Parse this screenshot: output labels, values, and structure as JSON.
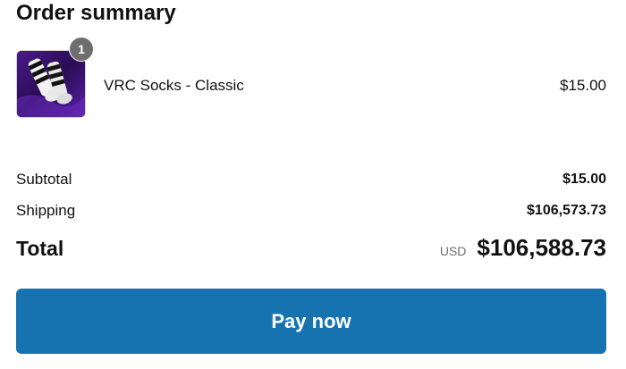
{
  "summary": {
    "title": "Order summary"
  },
  "line_item": {
    "quantity": "1",
    "name": "VRC Socks - Classic",
    "price": "$15.00",
    "thumbnail_icon": "socks-product-image"
  },
  "costs": {
    "subtotal_label": "Subtotal",
    "subtotal_value": "$15.00",
    "shipping_label": "Shipping",
    "shipping_value": "$106,573.73"
  },
  "total": {
    "label": "Total",
    "currency": "USD",
    "value": "$106,588.73"
  },
  "actions": {
    "pay_label": "Pay now"
  },
  "colors": {
    "button": "#1773b0",
    "badge": "#6e6e6e",
    "thumbnail_bg": "#2a0c54"
  }
}
